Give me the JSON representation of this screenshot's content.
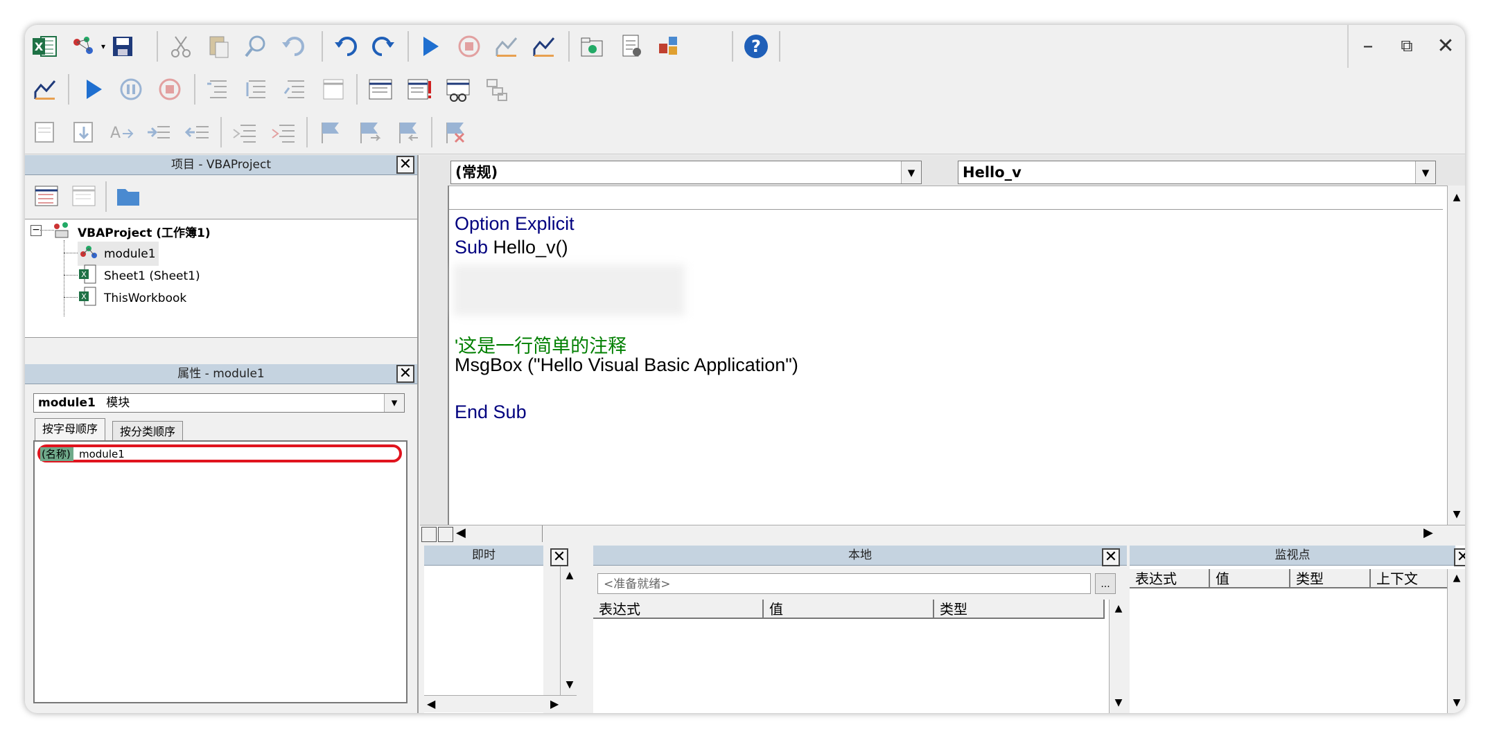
{
  "window_controls": {
    "minimize": "–",
    "restore": "⧉",
    "close": "✕"
  },
  "project_panel": {
    "title": "项目 - VBAProject",
    "close": "✕",
    "tree": [
      {
        "label": "VBAProject (工作簿1)",
        "level": 0
      },
      {
        "label": "module1",
        "level": 1
      },
      {
        "label": "Sheet1 (Sheet1)",
        "level": 1
      },
      {
        "label": "ThisWorkbook",
        "level": 1
      }
    ],
    "expander": "−"
  },
  "properties_panel": {
    "title": "属性 - module1",
    "close": "✕",
    "object_combo": "module1",
    "object_type": "模块",
    "tabs": [
      "按字母顺序",
      "按分类顺序"
    ],
    "rows": [
      {
        "name": "(名称)",
        "value": "module1"
      }
    ]
  },
  "code_window": {
    "object_combo": "(常规)",
    "procedure_combo": "Hello_v",
    "lines": [
      {
        "kw": "Option Explicit",
        "txt": ""
      },
      {
        "kw": "Sub ",
        "txt": "Hello_v()"
      },
      {
        "cm": "'这是一行简单的注释"
      },
      {
        "txt": "MsgBox (\"Hello Visual Basic Application\")"
      },
      {
        "kw": "End Sub"
      }
    ]
  },
  "immediate_panel": {
    "title": "即时",
    "close": "✕"
  },
  "locals_panel": {
    "title": "本地",
    "close": "✕",
    "status": "<准备就绪>",
    "ellipsis": "...",
    "columns": [
      "表达式",
      "值",
      "类型"
    ]
  },
  "watch_panel": {
    "title": "监视点",
    "close": "✕",
    "columns": [
      "表达式",
      "值",
      "类型",
      "上下文"
    ]
  },
  "colors": {
    "keyword": "#00007f",
    "comment": "#007f00",
    "panel_title_bg": "#c5d3e0",
    "highlight_ring": "#e0141e"
  }
}
